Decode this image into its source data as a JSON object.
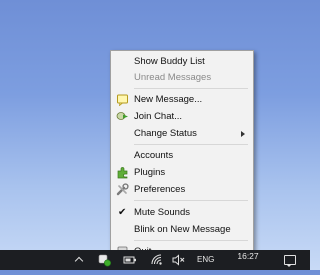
{
  "menu": {
    "items": [
      {
        "label": "Show Buddy List",
        "icon": null
      },
      {
        "label": "Unread Messages",
        "icon": null,
        "disabled": true
      },
      {
        "label": "New Message...",
        "icon": "new-message-icon"
      },
      {
        "label": "Join Chat...",
        "icon": "join-chat-icon"
      },
      {
        "label": "Change Status",
        "icon": null,
        "submenu": true
      },
      {
        "label": "Accounts",
        "icon": null
      },
      {
        "label": "Plugins",
        "icon": "plugins-icon"
      },
      {
        "label": "Preferences",
        "icon": "preferences-icon"
      },
      {
        "label": "Mute Sounds",
        "icon": "checkmark-icon",
        "checked": true
      },
      {
        "label": "Blink on New Message",
        "icon": null
      },
      {
        "label": "Quit",
        "icon": "quit-icon"
      }
    ]
  },
  "taskbar": {
    "language": "ENG",
    "time": "16:27",
    "date": "",
    "icons": [
      "show-hidden-icons-chevron",
      "pidgin-tray-icon",
      "battery-icon",
      "wifi-icon",
      "volume-muted-icon",
      "notification-icon"
    ]
  },
  "colors": {
    "menu_bg": "#f2f2f2",
    "taskbar_bg": "#1c1e22",
    "desktop_top": "#6f8fd6",
    "desktop_bottom": "#c8daf6"
  }
}
